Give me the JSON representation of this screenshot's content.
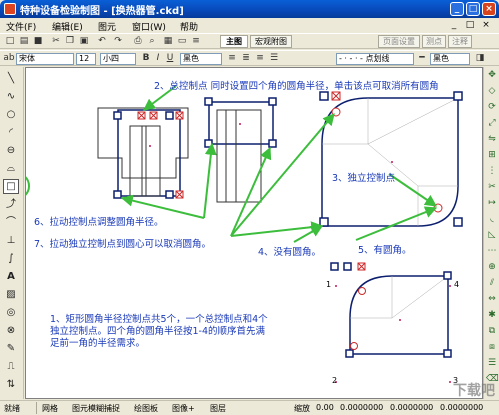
{
  "window": {
    "title": "特种设备检验制图 - [换热器管.ckd]",
    "minimize": "_",
    "maximize": "□",
    "close": "×"
  },
  "menu": {
    "items": [
      "文件(F)",
      "编辑(E)",
      "图元",
      "窗口(W)",
      "帮助"
    ],
    "right_controls": [
      "_",
      "□",
      "×"
    ]
  },
  "toolbar1": {
    "zoom_value": "",
    "tabs": [
      "主图",
      "宏观附图",
      "页面设置",
      "测点",
      "注释"
    ]
  },
  "toolbar2": {
    "font": "宋体",
    "size": "12",
    "font_size_name": "小四",
    "color1": "黑色",
    "line_style": "- · - · - 点划线",
    "color2": "黑色"
  },
  "annotations": {
    "n2": "2、总控制点 同时设置四个角的圆角半径，单击该点可取消所有圆角",
    "n3": "3、独立控制点",
    "n6": "6、拉动控制点调整圆角半径。",
    "n7": "7、拉动独立控制点到圆心可以取消圆角。",
    "n4": "4、没有圆角。",
    "n5": "5、有圆角。",
    "n1_line1": "1、矩形圆角半径控制点共5个，一个总控制点和4个",
    "n1_line2": "独立控制点。四个角的圆角半径按1-4的顺序首先满",
    "n1_line3": "足前一角的半径需求。",
    "corner1": "1",
    "corner2": "2",
    "corner3": "3",
    "corner4": "4"
  },
  "status": {
    "items": [
      "就绪",
      "网格",
      "图元模糊捕捉",
      "绘图板",
      "图像+",
      "图层"
    ],
    "zoom_label": "缩放",
    "zoom": "0.00",
    "x": "0.0000000",
    "y": "0.0000000",
    "z": "0.0000000"
  },
  "watermark": "下载吧",
  "colors": {
    "title_blue": "#0848b8",
    "canvas_bg": "#ffffff",
    "annotation_blue": "#1a3ab8",
    "shape_navy": "#0c1f6e",
    "handle_red": "#cc2a2a",
    "arrow_green": "#3cbd3c"
  }
}
